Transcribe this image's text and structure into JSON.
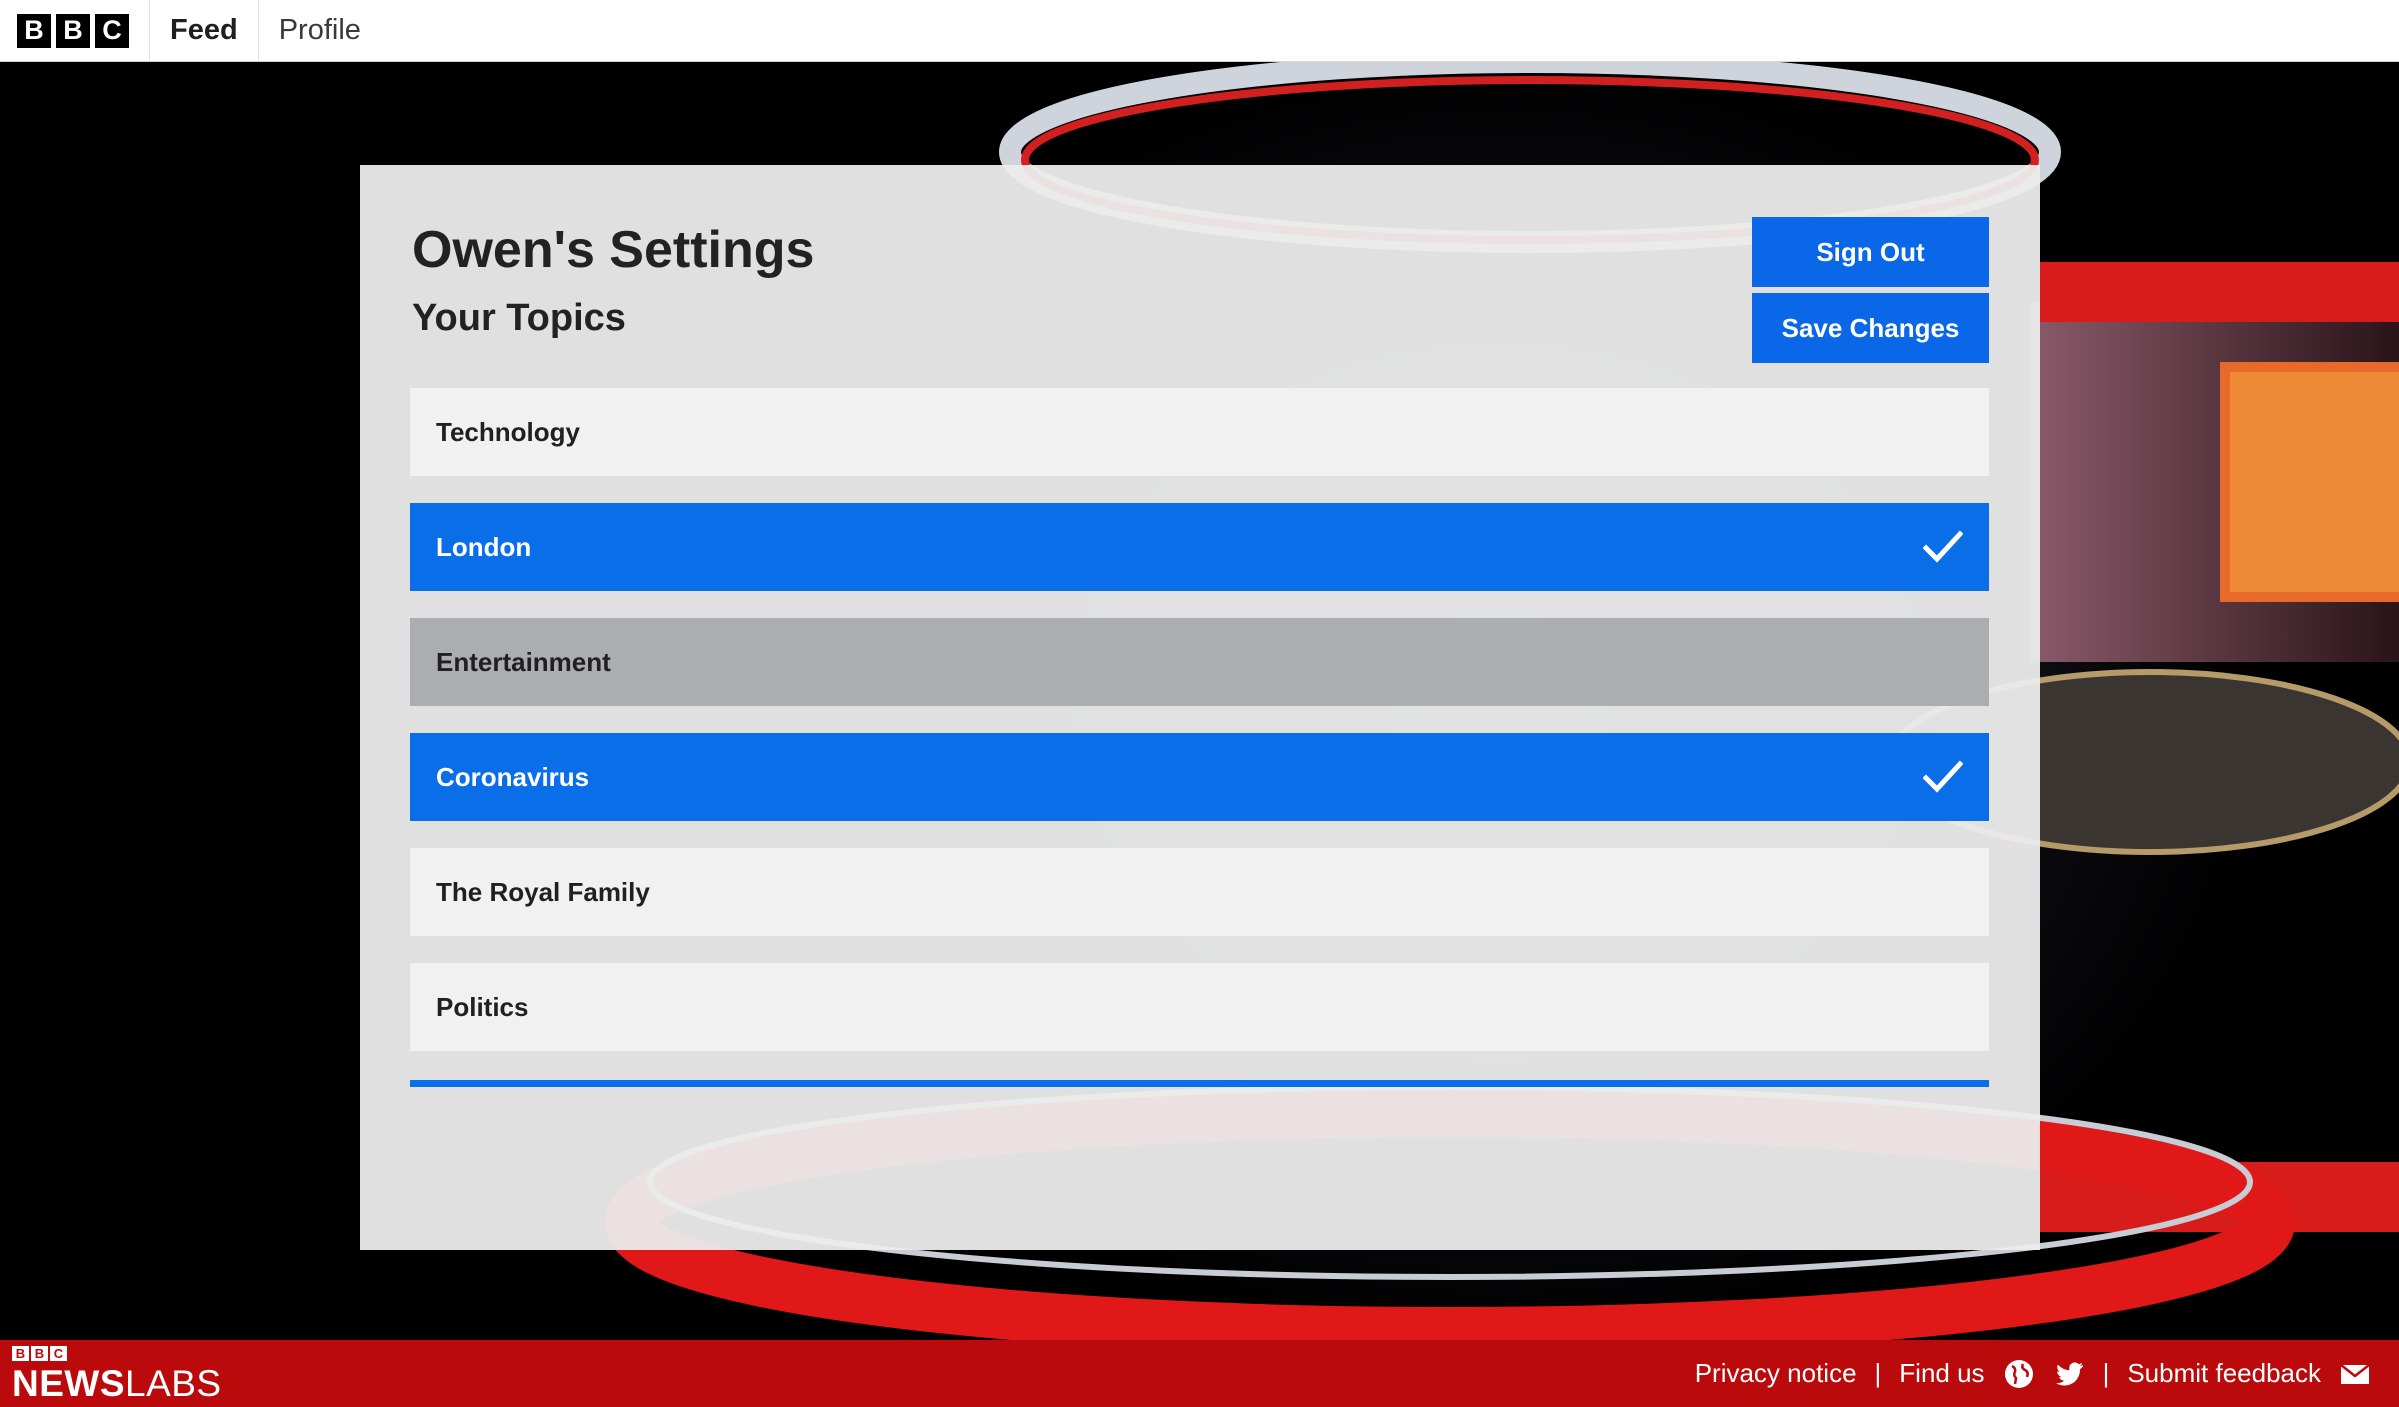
{
  "nav": {
    "logo_letters": [
      "B",
      "B",
      "C"
    ],
    "items": [
      {
        "label": "Feed",
        "active": true
      },
      {
        "label": "Profile",
        "active": false
      }
    ]
  },
  "settings": {
    "title": "Owen's Settings",
    "subtitle": "Your Topics",
    "sign_out_label": "Sign Out",
    "save_label": "Save Changes",
    "topics": [
      {
        "label": "Technology",
        "state": "unselected"
      },
      {
        "label": "London",
        "state": "selected"
      },
      {
        "label": "Entertainment",
        "state": "hover"
      },
      {
        "label": "Coronavirus",
        "state": "selected"
      },
      {
        "label": "The Royal Family",
        "state": "unselected"
      },
      {
        "label": "Politics",
        "state": "unselected"
      }
    ]
  },
  "footer": {
    "logo_letters": [
      "B",
      "B",
      "C"
    ],
    "logo_news": "NEWS",
    "logo_labs": "LABS",
    "privacy_label": "Privacy notice",
    "separator": "|",
    "find_us_label": "Find us",
    "feedback_label": "Submit feedback",
    "icons": [
      "globe-icon",
      "twitter-icon",
      "mail-icon"
    ]
  },
  "colors": {
    "accent_blue": "#0a6ee9",
    "footer_red": "#bb0a0c",
    "hover_grey": "#acadb1",
    "panel_bg": "#ececec"
  }
}
